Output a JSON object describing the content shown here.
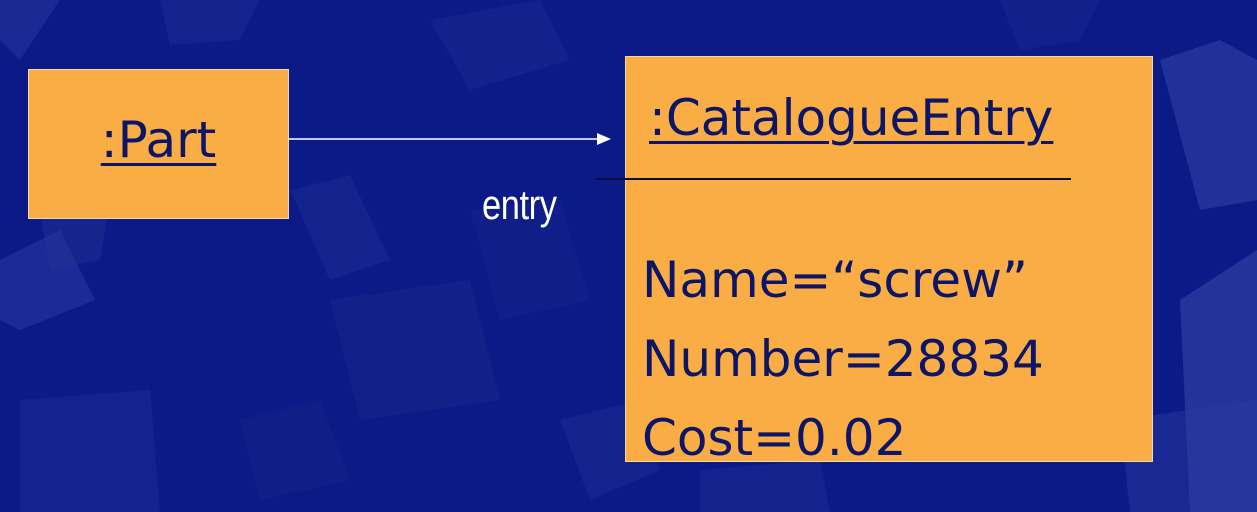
{
  "diagram": {
    "part_object": {
      "name": ":Part"
    },
    "association": {
      "role_label": "entry"
    },
    "catalogue_entry_object": {
      "name": ":CatalogueEntry",
      "attributes": [
        "Name=“screw”",
        "Number=28834",
        "Cost=0.02"
      ]
    }
  },
  "colors": {
    "background": "#0b1a86",
    "object_fill": "#fbad45",
    "object_text": "#0c1566",
    "connector": "#ffffff"
  }
}
